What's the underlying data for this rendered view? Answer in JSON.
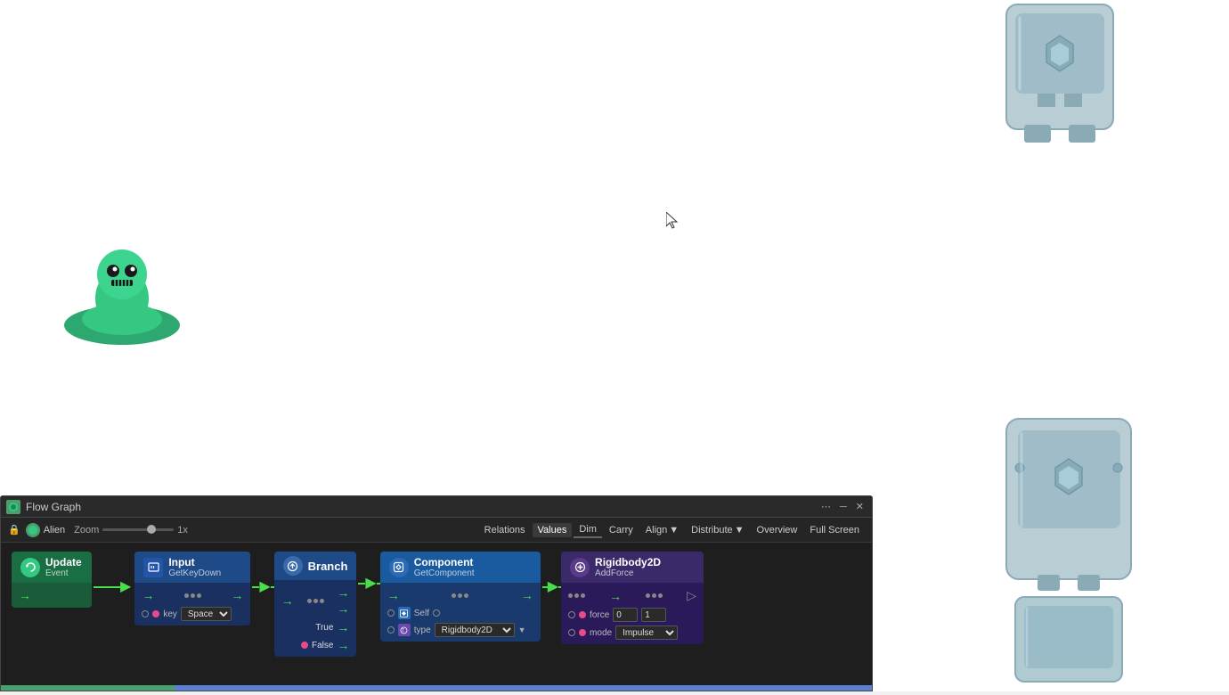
{
  "canvas": {
    "background": "#ffffff"
  },
  "panel": {
    "title": "Flow Graph",
    "zoom_label": "Zoom",
    "zoom_value": "1x",
    "alien_label": "Alien",
    "toolbar_buttons": [
      {
        "id": "relations",
        "label": "Relations"
      },
      {
        "id": "values",
        "label": "Values"
      },
      {
        "id": "dim",
        "label": "Dim"
      },
      {
        "id": "carry",
        "label": "Carry"
      },
      {
        "id": "align",
        "label": "Align"
      },
      {
        "id": "distribute",
        "label": "Distribute"
      },
      {
        "id": "overview",
        "label": "Overview"
      },
      {
        "id": "fullscreen",
        "label": "Full Screen"
      }
    ]
  },
  "nodes": {
    "update": {
      "title": "Update",
      "subtitle": "Event",
      "color_header": "#1a8a55",
      "color_body": "#1a5c3a"
    },
    "input": {
      "title": "Input",
      "subtitle": "GetKeyDown",
      "color_header": "#1e4a88",
      "color_body": "#1a3060",
      "param_key_label": "key",
      "param_key_value": "Space"
    },
    "branch": {
      "title": "Branch",
      "color_header": "#1e4a88",
      "color_body": "#1a3060",
      "true_label": "True",
      "false_label": "False"
    },
    "component": {
      "title": "Component",
      "subtitle": "GetComponent",
      "color_header": "#1a5a9e",
      "color_body": "#1a3a6e",
      "param_self_label": "Self",
      "param_type_label": "type",
      "param_type_value": "Rigidbody2D"
    },
    "rigidbody": {
      "title": "Rigidbody2D",
      "subtitle": "AddForce",
      "color_header": "#3a2a6a",
      "color_body": "#2a1a5a",
      "param_force_label": "force",
      "param_force_x": "0",
      "param_force_y": "1",
      "param_mode_label": "mode",
      "param_mode_value": "Impulse"
    }
  },
  "icons": {
    "lock": "🔒",
    "settings": "⚙",
    "close": "✕",
    "more": "⋯",
    "minimize": "─",
    "maximize": "□"
  }
}
